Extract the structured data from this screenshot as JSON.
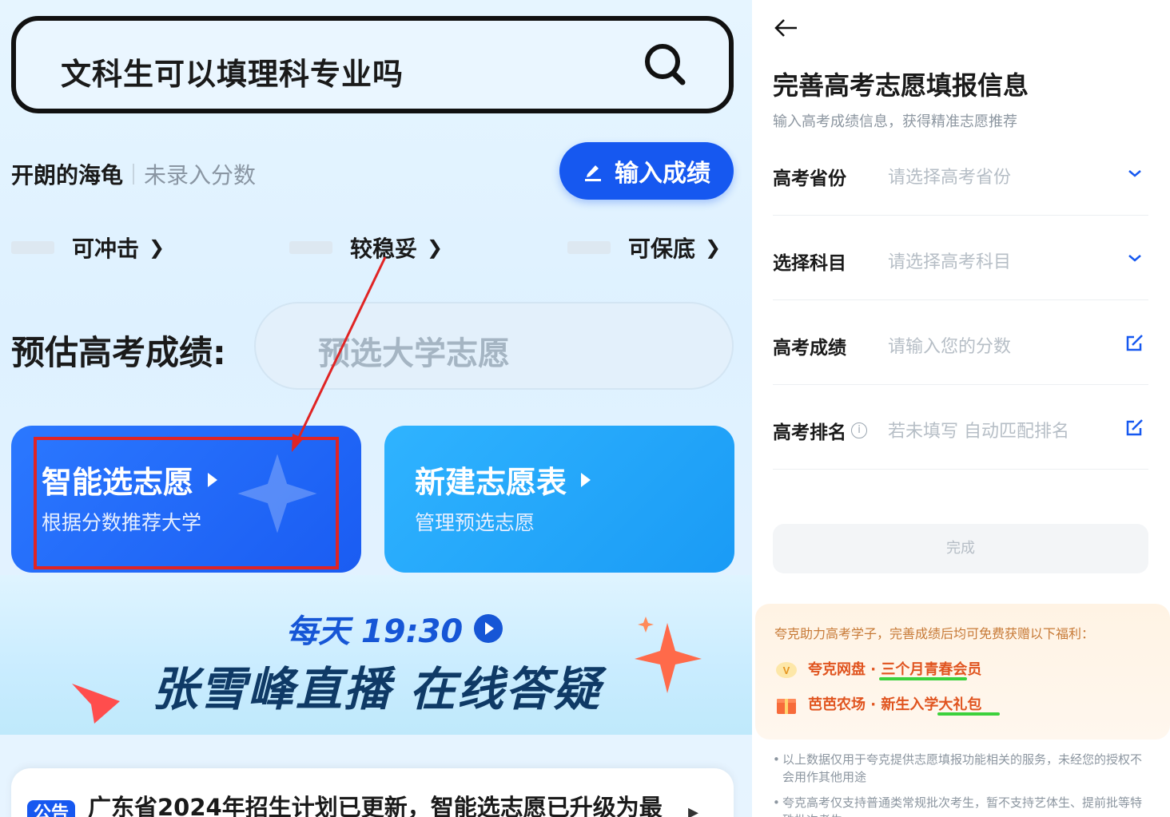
{
  "left": {
    "search": {
      "query": "文科生可以填理科专业吗"
    },
    "user": {
      "name": "开朗的海龟",
      "status": "未录入分数"
    },
    "enter_score_button": "输入成绩",
    "categories": [
      {
        "label": "可冲击"
      },
      {
        "label": "较稳妥"
      },
      {
        "label": "可保底"
      }
    ],
    "estimate": {
      "label": "预估高考成绩:",
      "placeholder": "预选大学志愿"
    },
    "cards": [
      {
        "title": "智能选志愿",
        "subtitle": "根据分数推荐大学"
      },
      {
        "title": "新建志愿表",
        "subtitle": "管理预选志愿"
      }
    ],
    "live": {
      "time": "每天 19:30",
      "title": "张雪峰直播 在线答疑"
    },
    "notice": {
      "badge": "公告",
      "text": "广东省2024年招生计划已更新，智能选志愿已升级为最"
    }
  },
  "right": {
    "title": "完善高考志愿填报信息",
    "subtitle": "输入高考成绩信息，获得精准志愿推荐",
    "fields": [
      {
        "label": "高考省份",
        "placeholder": "请选择高考省份",
        "icon": "chevron-down-icon"
      },
      {
        "label": "选择科目",
        "placeholder": "请选择高考科目",
        "icon": "chevron-down-icon"
      },
      {
        "label": "高考成绩",
        "placeholder": "请输入您的分数",
        "icon": "edit-icon"
      },
      {
        "label": "高考排名",
        "placeholder": "若未填写 自动匹配排名",
        "icon": "edit-icon"
      }
    ],
    "done_button": "完成",
    "benefits": {
      "intro": "夸克助力高考学子，完善成绩后均可免费获赠以下福利：",
      "items": [
        {
          "text": "夸克网盘 · 三个月青春会员"
        },
        {
          "text": "芭芭农场 · 新生入学大礼包"
        }
      ]
    },
    "disclaimers": [
      "以上数据仅用于夸克提供志愿填报功能相关的服务，未经您的授权不会用作其他用途",
      "夸克高考仅支持普通类常规批次考生，暂不支持艺体生、提前批等特殊批次考生"
    ]
  },
  "colors": {
    "primary_blue": "#1658f0",
    "light_blue_card": "#1a9bf5",
    "highlight_red": "#e02424",
    "benefit_orange": "#e0541f"
  }
}
